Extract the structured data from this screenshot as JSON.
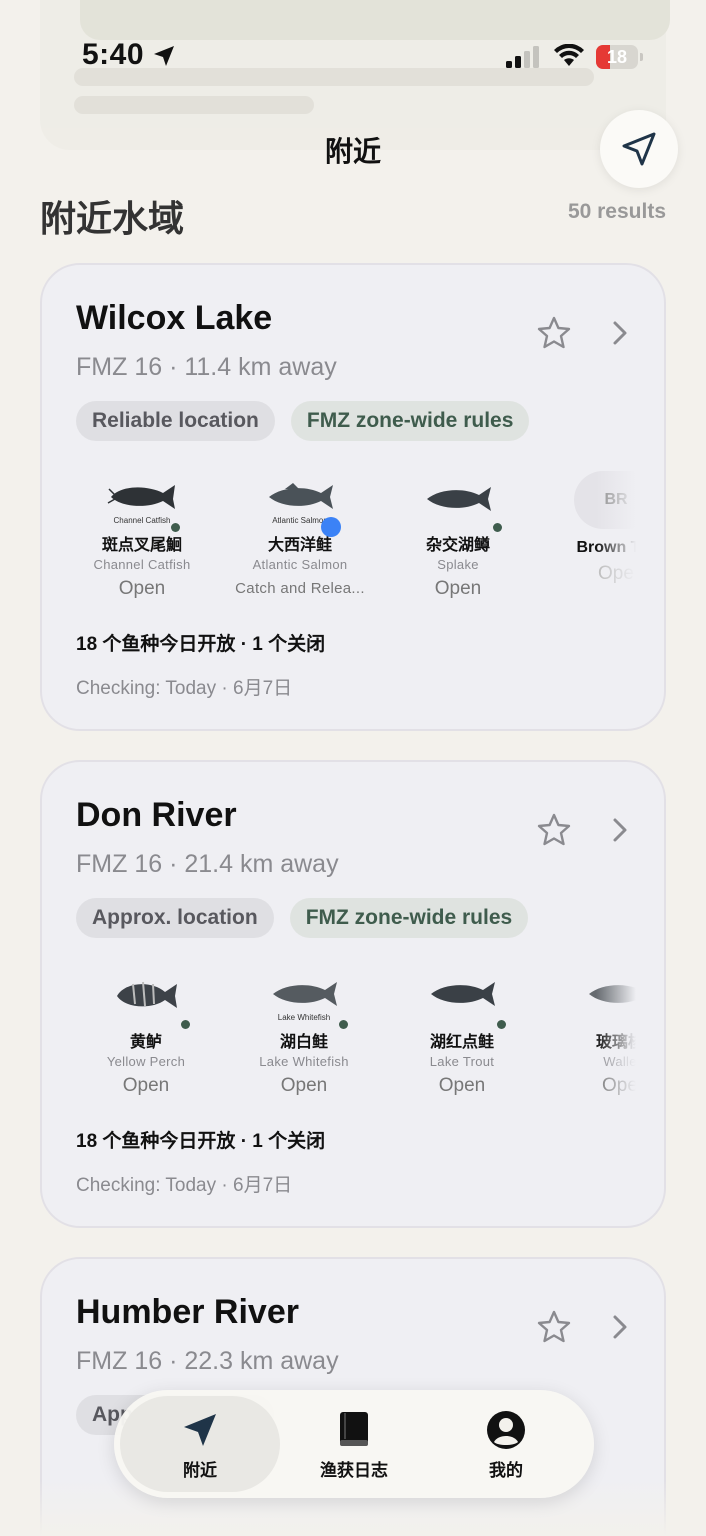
{
  "status": {
    "time": "5:40",
    "battery": "18"
  },
  "header": {
    "title": "附近",
    "section_title": "附近水域",
    "results": "50 results"
  },
  "cards": [
    {
      "title": "Wilcox Lake",
      "subtitle": "FMZ 16 · 11.4 km away",
      "tags": [
        "Reliable location",
        "FMZ zone-wide rules"
      ],
      "species": [
        {
          "caption": "Channel Catfish",
          "cn": "斑点叉尾鮰",
          "en": "Channel Catfish",
          "status": "Open"
        },
        {
          "caption": "Atlantic Salmon",
          "cn": "大西洋鲑",
          "en": "Atlantic Salmon",
          "status": "Catch and Relea..."
        },
        {
          "caption": "",
          "cn": "杂交湖鳟",
          "en": "Splake",
          "status": "Open"
        },
        {
          "abbr": "BR",
          "cn": "Brown Tro",
          "en": "",
          "status": "Ope"
        }
      ],
      "summary": "18 个鱼种今日开放 · 1 个关闭",
      "checking": "Checking: Today · 6月7日"
    },
    {
      "title": "Don River",
      "subtitle": "FMZ 16 · 21.4 km away",
      "tags": [
        "Approx. location",
        "FMZ zone-wide rules"
      ],
      "species": [
        {
          "caption": "",
          "cn": "黄鲈",
          "en": "Yellow Perch",
          "status": "Open"
        },
        {
          "caption": "Lake Whitefish",
          "cn": "湖白鲑",
          "en": "Lake Whitefish",
          "status": "Open"
        },
        {
          "caption": "",
          "cn": "湖红点鲑",
          "en": "Lake Trout",
          "status": "Open"
        },
        {
          "caption": "",
          "cn": "玻璃梭",
          "en": "Walle",
          "status": "Ope"
        }
      ],
      "summary": "18 个鱼种今日开放 · 1 个关闭",
      "checking": "Checking: Today · 6月7日"
    },
    {
      "title": "Humber River",
      "subtitle": "FMZ 16 · 22.3 km away",
      "tags": [
        "Approx. location"
      ]
    }
  ],
  "tabbar": {
    "nearby": "附近",
    "log": "渔获日志",
    "me": "我的"
  },
  "colors": {
    "accent": "#1f3448",
    "green": "#3f5c4d",
    "bg": "#f3f1ec",
    "card": "#efeff3"
  }
}
